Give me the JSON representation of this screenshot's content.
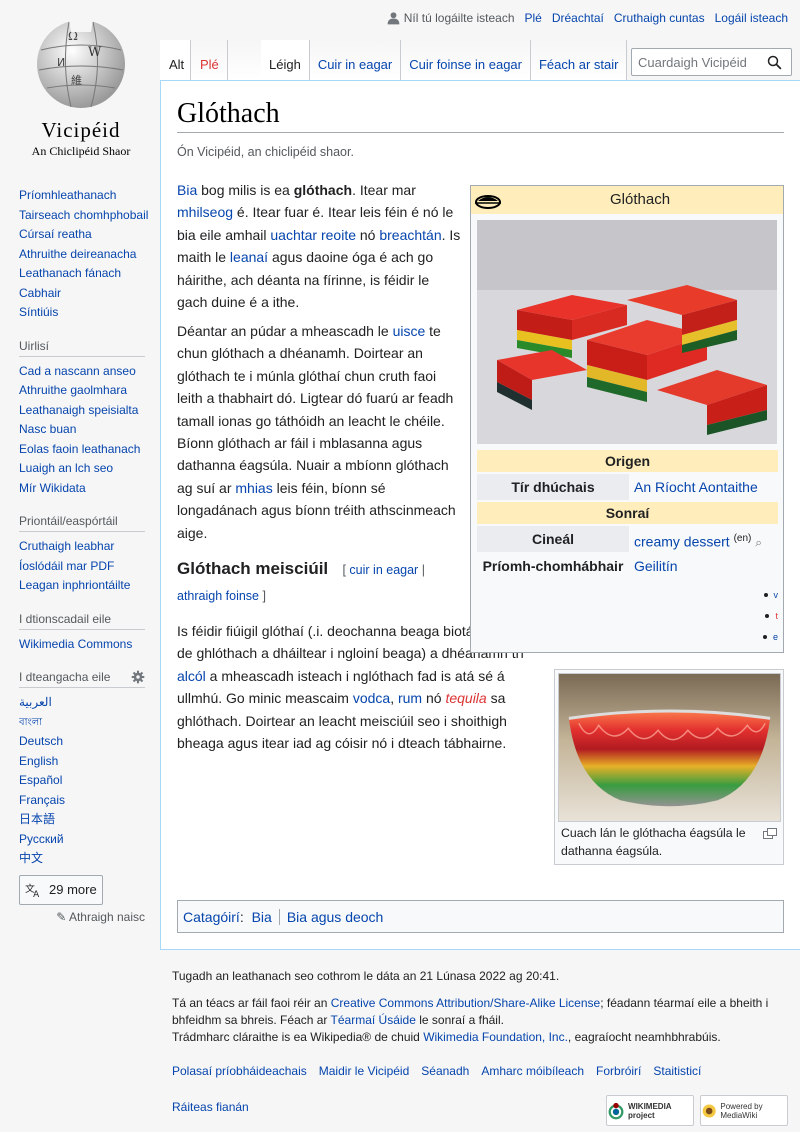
{
  "logo": {
    "wordmark": "Vicipéid",
    "tagline": "An Chiclipéid Shaor"
  },
  "personal": {
    "not_logged_in": "Níl tú logáilte isteach",
    "links": [
      "Plé",
      "Dréachtaí",
      "Cruthaigh cuntas",
      "Logáil isteach"
    ]
  },
  "tabs": {
    "left": [
      {
        "label": "Alt",
        "selected": true
      },
      {
        "label": "Plé",
        "selected": false,
        "red": true
      }
    ],
    "right": [
      "Léigh",
      "Cuir in eagar",
      "Cuir foinse in eagar",
      "Féach ar stair"
    ]
  },
  "search": {
    "placeholder": "Cuardaigh Vicipéid"
  },
  "sidebar": {
    "nav": [
      "Príomhleathanach",
      "Tairseach chomhphobail",
      "Cúrsaí reatha",
      "Athruithe deireanacha",
      "Leathanach fánach",
      "Cabhair",
      "Síntiúis"
    ],
    "tools_heading": "Uirlisí",
    "tools": [
      "Cad a nascann anseo",
      "Athruithe gaolmhara",
      "Leathanaigh speisialta",
      "Nasc buan",
      "Eolas faoin leathanach",
      "Luaigh an lch seo",
      "Mír Wikidata"
    ],
    "print_heading": "Priontáil/easpórtáil",
    "print": [
      "Cruthaigh leabhar",
      "Íoslódáil mar PDF",
      "Leagan inphriontáilte"
    ],
    "other_heading": "I dtionscadail eile",
    "other": [
      "Wikimedia Commons"
    ],
    "lang_heading": "I dteangacha eile",
    "langs": [
      "العربية",
      "বাংলা",
      "Deutsch",
      "English",
      "Español",
      "Français",
      "日本語",
      "Русский",
      "中文"
    ],
    "more_button": "29 more",
    "edit_links": "Athraigh naisc"
  },
  "article": {
    "title": "Glóthach",
    "site_sub": "Ón Vicipéid, an chiclipéid shaor.",
    "p1": {
      "bia": "Bia",
      "t1": " bog milis is ea ",
      "bold": "glóthach",
      "t2": ". Itear mar ",
      "mhilseog": "mhilseog",
      "t3": " é. Itear fuar é. Itear leis féin é nó le bia eile amhail ",
      "uachtar": "uachtar reoite",
      "t4": " nó ",
      "breachtan": "breachtán",
      "t5": ". Is maith le ",
      "leanai": "leanaí",
      "t6": " agus daoine óga é ach go háirithe, ach déanta na fírinne, is féidir le gach duine é a ithe."
    },
    "p2": {
      "t1": "Déantar an púdar a mheascadh le ",
      "uisce": "uisce",
      "t2": " te chun glóthach a dhéanamh. Doirtear an glóthach te i múnla glóthaí chun cruth faoi leith a thabhairt dó. Ligtear dó fuarú ar feadh tamall ionas go táthóidh an leacht le chéile. Bíonn glóthach ar fáil i mblasanna agus dathanna éagsúla. Nuair a mbíonn glóthach ag suí ar ",
      "mhias": "mhias",
      "t3": " leis féin, bíonn sé longadánach agus bíonn tréith athscinmeach aige."
    },
    "section": {
      "title": "Glóthach meisciúil",
      "edit": "cuir in eagar",
      "edit_source": "athraigh foinse"
    },
    "p3": {
      "t1": "Is féidir fiúigil glóthaí (.i. deochanna beaga biotáille déanta de ghlóthach a dháiltear i ngloiní beaga) a dhéanamh trí ",
      "alcol": "alcól",
      "t2": " a mheascadh isteach i nglóthach fad is atá sé á ullmhú. Go minic meascaim ",
      "vodca": "vodca",
      "rum": "rum",
      "t3": " nó ",
      "tequila": "tequila",
      "t4": " sa ghlóthach. Doirtear an leacht meisciúil seo i shoithigh bheaga agus itear iad ag cóisir nó i dteach tábhairne."
    }
  },
  "infobox": {
    "title": "Glóthach",
    "origin_heading": "Origen",
    "country_label": "Tír dhúchais",
    "country_value": "An Ríocht Aontaithe",
    "type_heading": "Sonraí",
    "kind_label": "Cineál",
    "kind_value": "creamy dessert",
    "kind_lang": "(en)",
    "ingredient_label": "Príomh-chomhábhair",
    "ingredient_value": "Geilitín",
    "nav": [
      "v",
      "t",
      "e"
    ]
  },
  "thumb": {
    "caption": "Cuach lán le glóthacha éagsúla le dathanna éagsúla."
  },
  "categories": {
    "label": "Catagóirí",
    "items": [
      "Bia",
      "Bia agus deoch"
    ]
  },
  "footer": {
    "lastmod": "Tugadh an leathanach seo cothrom le dáta an 21 Lúnasa 2022 ag 20:41.",
    "license_t1": "Tá an téacs ar fáil faoi réir an ",
    "license_link": "Creative Commons Attribution/Share-Alike License",
    "license_t2": "; féadann téarmaí eile a bheith i bhfeidhm sa bhreis. Féach ar ",
    "terms_link": "Téarmaí Úsáide",
    "license_t3": " le sonraí a fháil.",
    "trademark_t1": "Trádmharc cláraithe is ea Wikipedia® de chuid ",
    "trademark_link": "Wikimedia Foundation, Inc.",
    "trademark_t2": ", eagraíocht neamhbhrabúis.",
    "links": [
      "Polasaí príobháideachais",
      "Maidir le Vicipéid",
      "Séanadh",
      "Amharc móibíleach",
      "Forbróirí",
      "Staitisticí"
    ],
    "cookies": "Ráiteas fianán",
    "badge1": "WIKIMEDIA project",
    "badge2": "Powered by MediaWiki"
  }
}
